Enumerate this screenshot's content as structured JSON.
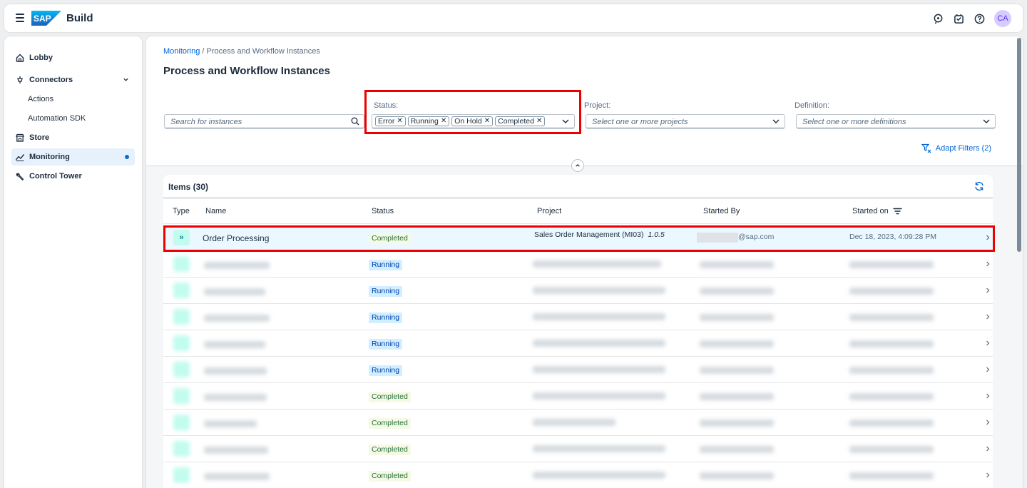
{
  "shell": {
    "logo_text": "SAP",
    "brand": "Build",
    "avatar_initials": "CA"
  },
  "sidebar": {
    "items": [
      {
        "label": "Lobby",
        "icon": "home-icon"
      },
      {
        "label": "Connectors",
        "icon": "connector-icon"
      },
      {
        "label": "Actions",
        "icon": ""
      },
      {
        "label": "Automation SDK",
        "icon": ""
      },
      {
        "label": "Store",
        "icon": "store-icon"
      },
      {
        "label": "Monitoring",
        "icon": "monitoring-icon"
      },
      {
        "label": "Control Tower",
        "icon": "wrench-icon"
      }
    ]
  },
  "breadcrumb": {
    "link": "Monitoring",
    "separator": " / ",
    "current": "Process and Workflow Instances"
  },
  "page_title": "Process and Workflow Instances",
  "filters": {
    "search_placeholder": "Search for instances",
    "status_label": "Status:",
    "status_tokens": [
      "Error",
      "Running",
      "On Hold",
      "Completed"
    ],
    "project_label": "Project:",
    "project_placeholder": "Select one or more projects",
    "definition_label": "Definition:",
    "definition_placeholder": "Select one or more definitions",
    "adapt_filters": "Adapt Filters (2)"
  },
  "table": {
    "title": "Items (30)",
    "columns": [
      "Type",
      "Name",
      "Status",
      "Project",
      "Started By",
      "Started on"
    ],
    "selected_row": {
      "type_icon": "»",
      "name": "Order Processing",
      "status": "Completed",
      "project": "Sales Order Management (MI03)",
      "version": "1.0.5",
      "started_by_suffix": "@sap.com",
      "started_on": "Dec 18, 2023, 4:09:28 PM"
    },
    "rows": [
      {
        "status": "Running",
        "kind": "running"
      },
      {
        "status": "Running",
        "kind": "running"
      },
      {
        "status": "Running",
        "kind": "running"
      },
      {
        "status": "Running",
        "kind": "running"
      },
      {
        "status": "Running",
        "kind": "running"
      },
      {
        "status": "Completed",
        "kind": "completed"
      },
      {
        "status": "Completed",
        "kind": "completed"
      },
      {
        "status": "Completed",
        "kind": "completed"
      },
      {
        "status": "Completed",
        "kind": "completed"
      }
    ]
  },
  "colors": {
    "accent": "#0064d9",
    "highlight": "#e00000",
    "completed_bg": "#f5fae5",
    "running_bg": "#d1efff"
  }
}
